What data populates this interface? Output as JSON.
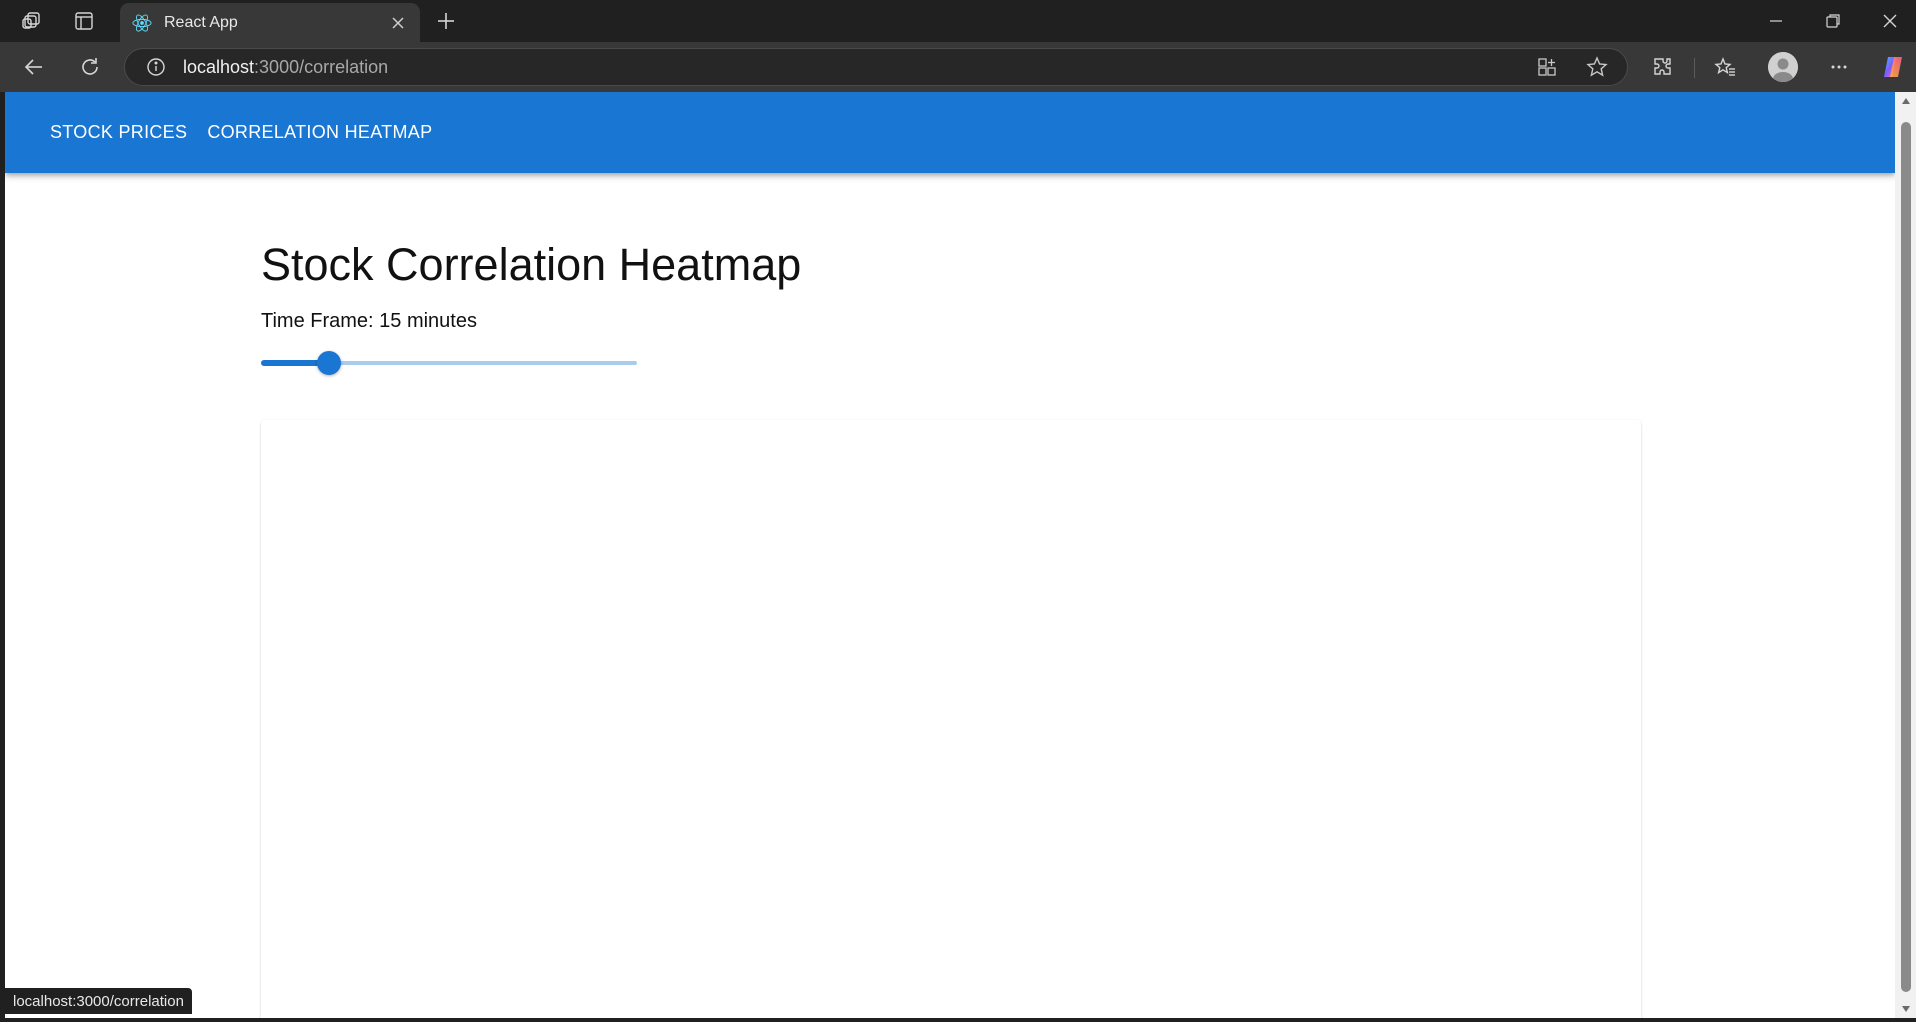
{
  "browser": {
    "tab": {
      "title": "React App",
      "favicon": "react-logo-icon"
    },
    "address": {
      "host": "localhost",
      "path": ":3000/correlation"
    },
    "status_url": "localhost:3000/correlation"
  },
  "appbar": {
    "color": "#1976d2",
    "links": [
      {
        "label": "STOCK PRICES"
      },
      {
        "label": "CORRELATION HEATMAP"
      }
    ]
  },
  "main": {
    "title": "Stock Correlation Heatmap",
    "timeframe_label": "Time Frame: 15 minutes",
    "slider": {
      "value_fraction": 0.18,
      "color": "#1976d2"
    }
  },
  "icons": {
    "workspaces": "workspaces-icon",
    "tab_actions": "tab-actions-icon",
    "new_tab": "plus-icon",
    "back": "back-arrow-icon",
    "refresh": "refresh-icon",
    "site_info": "info-icon",
    "app_view": "app-available-icon",
    "favorite": "star-icon",
    "extensions": "puzzle-icon",
    "favorites": "favorites-icon",
    "more": "more-icon",
    "copilot": "copilot-icon"
  }
}
